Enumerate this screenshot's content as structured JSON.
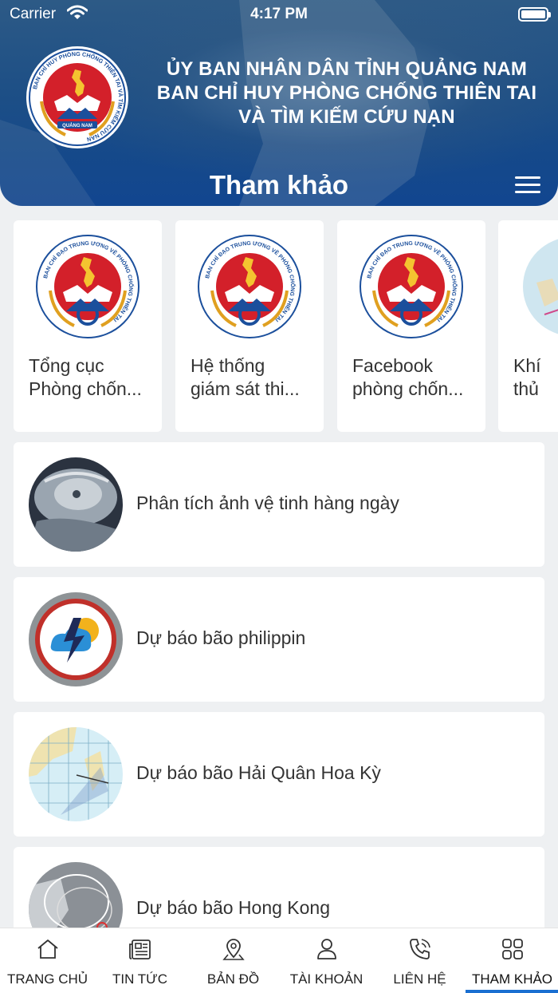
{
  "status": {
    "carrier": "Carrier",
    "time": "4:17 PM"
  },
  "header": {
    "org_line1": "ỦY BAN NHÂN DÂN TỈNH QUẢNG NAM",
    "org_line2": "BAN CHỈ HUY PHÒNG CHỐNG THIÊN TAI",
    "org_line3": "VÀ TÌM KIẾM CỨU NẠN",
    "title": "Tham khảo",
    "logo_ring_text": "BAN CHỈ HUY PHÒNG CHỐNG THIÊN TAI VÀ TÌM KIẾM CỨU NẠN",
    "logo_bottom_text": "QUẢNG NAM"
  },
  "cards": [
    {
      "line1": "Tổng cục",
      "line2": "Phòng chốn...",
      "emblem_text": "BAN CHỈ ĐẠO TRUNG ƯƠNG VỀ PHÒNG CHỐNG THIÊN TAI"
    },
    {
      "line1": "Hệ thống",
      "line2": "giám sát thi...",
      "emblem_text": "BAN CHỈ ĐẠO TRUNG ƯƠNG VỀ PHÒNG CHỐNG THIÊN TAI"
    },
    {
      "line1": "Facebook",
      "line2": "phòng chốn...",
      "emblem_text": "BAN CHỈ ĐẠO TRUNG ƯƠNG VỀ PHÒNG CHỐNG THIÊN TAI"
    },
    {
      "line1": "Khí",
      "line2": "thủ"
    }
  ],
  "items": [
    {
      "label": "Phân tích ảnh vệ tinh hàng ngày",
      "icon": "satellite-typhoon-image"
    },
    {
      "label": "Dự báo bão philippin",
      "icon": "weather-storm-logo"
    },
    {
      "label": "Dự báo bão Hải Quân Hoa Kỳ",
      "icon": "typhoon-track-map"
    },
    {
      "label": "Dự báo bão Hong Kong",
      "icon": "typhoon-forecast-map"
    }
  ],
  "tabs": [
    {
      "label": "TRANG CHỦ",
      "icon": "home-icon"
    },
    {
      "label": "TIN TỨC",
      "icon": "newspaper-icon"
    },
    {
      "label": "BẢN ĐỒ",
      "icon": "map-pin-icon"
    },
    {
      "label": "TÀI KHOẢN",
      "icon": "user-icon"
    },
    {
      "label": "LIÊN HỆ",
      "icon": "phone-icon"
    },
    {
      "label": "THAM KHẢO",
      "icon": "grid-icon",
      "active": true
    }
  ],
  "colors": {
    "header": "#1d4f86",
    "emblem_red": "#d3202a",
    "accent": "#1a6fd1",
    "background": "#eef0f2"
  }
}
